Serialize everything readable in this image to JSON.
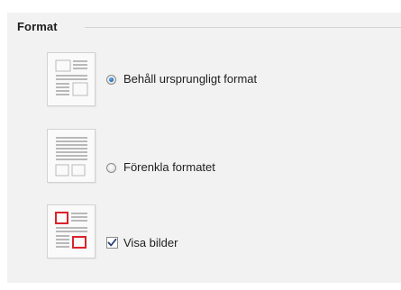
{
  "group": {
    "title": "Format"
  },
  "options": {
    "keep_format": {
      "label": "Behåll ursprungligt format",
      "control": "radio",
      "checked": true,
      "icon": "keep-source-format-icon"
    },
    "simplify_format": {
      "label": "Förenkla formatet",
      "control": "radio",
      "checked": false,
      "icon": "simplify-format-icon"
    },
    "show_images": {
      "label": "Visa bilder",
      "control": "checkbox",
      "checked": true,
      "icon": "show-images-icon"
    }
  },
  "colors": {
    "panel_bg": "#f2f2f2",
    "radio_selected": "#1b5fb0",
    "image_frame": "#d9242b",
    "text_lines": "#b9b9b9"
  }
}
